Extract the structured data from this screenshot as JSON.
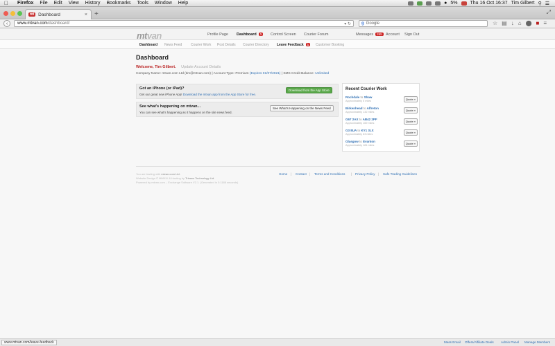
{
  "menubar": {
    "app": "Firefox",
    "items": [
      "File",
      "Edit",
      "View",
      "History",
      "Bookmarks",
      "Tools",
      "Window",
      "Help"
    ],
    "battery": "5%",
    "datetime": "Thu 16 Oct  16:37",
    "user": "Tim Gilbert"
  },
  "browser": {
    "tab_title": "Dashboard",
    "tab_favicon": "mt",
    "url_domain": "www.mtvan.com",
    "url_path": "/dashboard/",
    "search_placeholder": "Google"
  },
  "site": {
    "logo_a": "mt",
    "logo_b": "van",
    "nav": {
      "profile": "Profile Page",
      "dashboard": "Dashboard",
      "dashboard_badge": "1",
      "control": "Control Screen",
      "forum": "Courier Forum",
      "messages": "Messages",
      "messages_badge": "265",
      "account": "Account",
      "signout": "Sign Out"
    },
    "subnav": {
      "dashboard": "Dashboard",
      "news": "News Feed",
      "courier_work": "Courier Work",
      "post_details": "Post Details",
      "directory": "Courier Directory",
      "feedback": "Leave Feedback",
      "feedback_badge": "1",
      "booking": "Customer Booking"
    }
  },
  "dashboard": {
    "title": "Dashboard",
    "welcome": "Welcome, Tim Gilbert.",
    "update_link": "Update Account Details",
    "company_text": "Company Name: mtvan.com Ltd (tim@mtvan.com)  |  Account Type: Premium",
    "expires": "(Expires 01/07/2021)",
    "sms_text": "|  SMS Credit Balance:",
    "sms_value": "Unlimited"
  },
  "iphone_panel": {
    "heading": "Got an iPhone (or iPad)?",
    "text": "Get our great new iPhone App!",
    "link": "Download the mtvan app from the App Store for free.",
    "button": "Download from the App Store"
  },
  "news_panel": {
    "heading": "See what's happening on mtvan...",
    "text": "You can see what's happening as it happens on the site news feed.",
    "button": "See What's Happening on the News Feed"
  },
  "recent": {
    "title": "Recent Courier Work",
    "quote_label": "Quote »",
    "to_word": "to",
    "items": [
      {
        "from": "Rochdale",
        "to": "Shaw",
        "dist": "Approximately 5 miles"
      },
      {
        "from": "Birkenhead",
        "to": "Alfreton",
        "dist": "Approximately 132 miles"
      },
      {
        "from": "G67 2AX",
        "to": "AB42 2PF",
        "dist": "Approximately 169 miles"
      },
      {
        "from": "G3 8UA",
        "to": "KY1 3LX",
        "dist": "Approximately 63 miles"
      },
      {
        "from": "Glasgow",
        "to": "Evanton",
        "dist": "Approximately 181 miles"
      }
    ]
  },
  "footer": {
    "line1_a": "You are trading with",
    "line1_b": "mtvan.com Ltd.",
    "line2_a": "Website Design © MMXIV & Hosting by",
    "line2_b": "Trinaxo Technology Ltd.",
    "line3": "Powered by mtvan.com – Exchange Software V2.1. (Generated in 0.1186 seconds)",
    "links": {
      "home": "Home",
      "contact": "Contact",
      "terms": "Terms and Conditions",
      "privacy": "Privacy Policy",
      "safe": "Safe Trading Guidelines"
    },
    "sep": "|"
  },
  "statusbar": {
    "url": "www.mtvan.com/leave-feedback",
    "mass_email": "Mass Email",
    "affiliate": "Offers/Affiliate Deals",
    "admin": "Admin Panel",
    "manage": "Manage Members"
  },
  "colors": {
    "brand_red": "#b91e1e",
    "link_blue": "#2f6fb3",
    "green_button": "#5aa84a"
  }
}
